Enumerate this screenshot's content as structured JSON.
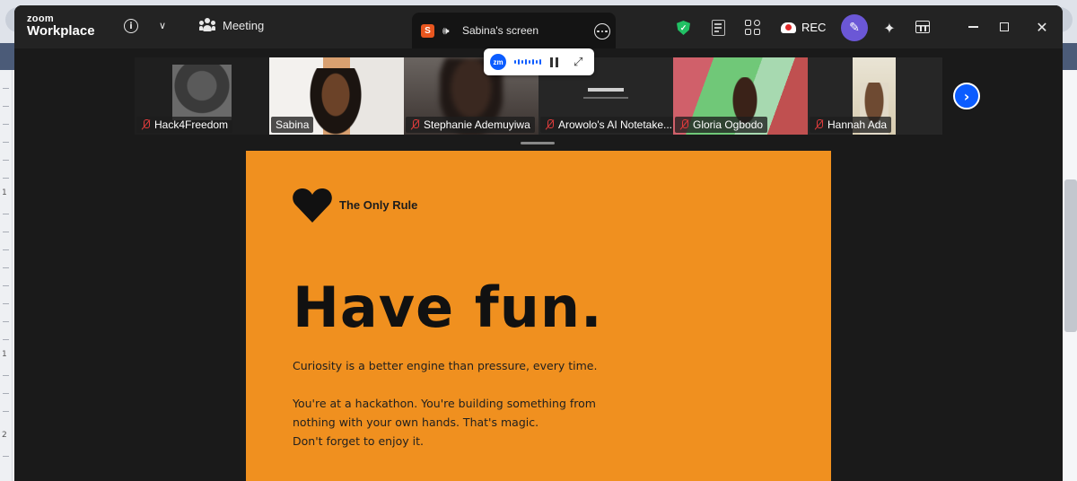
{
  "app": {
    "logo_line1": "zoom",
    "logo_line2": "Workplace"
  },
  "toolbar": {
    "meeting_label": "Meeting",
    "rec_label": "REC"
  },
  "share_tab": {
    "badge": "S",
    "label": "Sabina's screen"
  },
  "floating_bar": {
    "logo": "zm"
  },
  "participants": [
    {
      "name": "Hack4Freedom",
      "muted": true
    },
    {
      "name": "Sabina",
      "muted": false,
      "active": true
    },
    {
      "name": "Stephanie Ademuyiwa",
      "muted": true
    },
    {
      "name": "Arowolo's AI Notetake...",
      "muted": true
    },
    {
      "name": "Gloria Ogbodo",
      "muted": true
    },
    {
      "name": "Hannah Ada",
      "muted": true
    }
  ],
  "slide": {
    "rule_label": "The Only Rule",
    "headline": "Have fun.",
    "line1": "Curiosity is a better engine than pressure, every time.",
    "para2_line1": "You're at a hackathon. You're building something from",
    "para2_line2": "nothing with your own hands. That's magic.",
    "para2_line3": "Don't forget to enjoy it."
  },
  "ruler": {
    "marks": [
      "1",
      "1",
      "2"
    ]
  },
  "colors": {
    "slide_bg": "#f0901f",
    "accent": "#0b5cff",
    "active_border": "#3ed07a",
    "muted": "#e03c3c"
  }
}
